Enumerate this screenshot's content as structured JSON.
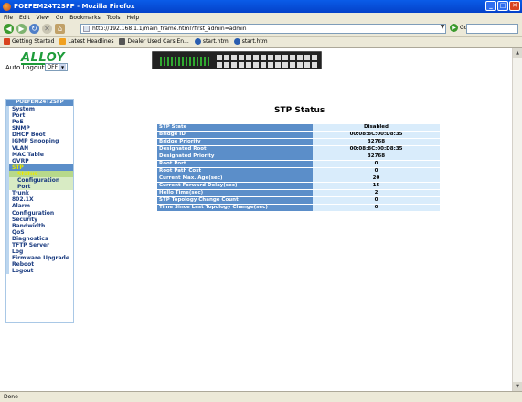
{
  "window": {
    "title": "POEFEM24T2SFP - Mozilla Firefox",
    "buttons": [
      "_",
      "□",
      "✕"
    ]
  },
  "menu": [
    "File",
    "Edit",
    "View",
    "Go",
    "Bookmarks",
    "Tools",
    "Help"
  ],
  "toolbar": {
    "url": "http://192.168.1.1/main_frame.html?first_admin=admin",
    "go_label": "Go"
  },
  "bookmarks": [
    {
      "label": "Getting Started",
      "color": "#d9431f"
    },
    {
      "label": "Latest Headlines",
      "color": "#f0a020"
    },
    {
      "label": "Dealer Used Cars En...",
      "color": "#555555"
    },
    {
      "label": "start.htm",
      "color": "#2a5db0"
    },
    {
      "label": "start.htm",
      "color": "#2a5db0"
    }
  ],
  "header": {
    "logo": "ALLOY",
    "auto_logout_label": "Auto Logout",
    "auto_logout_value": "OFF"
  },
  "sidebar": {
    "title": "POEFEM24T2SFP",
    "items": [
      {
        "label": "System"
      },
      {
        "label": "Port"
      },
      {
        "label": "PoE"
      },
      {
        "label": "SNMP"
      },
      {
        "label": "DHCP Boot"
      },
      {
        "label": "IGMP Snooping"
      },
      {
        "label": "VLAN"
      },
      {
        "label": "MAC Table"
      },
      {
        "label": "GVRP"
      },
      {
        "label": "STP"
      }
    ],
    "stp_sub": [
      {
        "label": "Status"
      },
      {
        "label": "Configuration"
      },
      {
        "label": "Port"
      }
    ],
    "items_after": [
      {
        "label": "Trunk"
      },
      {
        "label": "802.1X"
      },
      {
        "label": "Alarm"
      },
      {
        "label": "Configuration"
      },
      {
        "label": "Security"
      },
      {
        "label": "Bandwidth"
      },
      {
        "label": "QoS"
      },
      {
        "label": "Diagnostics"
      },
      {
        "label": "TFTP Server"
      },
      {
        "label": "Log"
      },
      {
        "label": "Firmware Upgrade"
      },
      {
        "label": "Reboot"
      },
      {
        "label": "Logout"
      }
    ]
  },
  "main": {
    "title": "STP Status",
    "rows": [
      {
        "label": "STP State",
        "value": "Disabled"
      },
      {
        "label": "Bridge ID",
        "value": "00:08:8C:00:D8:35"
      },
      {
        "label": "Bridge Priority",
        "value": "32768"
      },
      {
        "label": "Designated Root",
        "value": "00:08:8C:00:D8:35"
      },
      {
        "label": "Designated Priority",
        "value": "32768"
      },
      {
        "label": "Root Port",
        "value": "0"
      },
      {
        "label": "Root Path Cost",
        "value": "0"
      },
      {
        "label": "Current Max. Age(sec)",
        "value": "20"
      },
      {
        "label": "Current Forward Delay(sec)",
        "value": "15"
      },
      {
        "label": "Hello Time(sec)",
        "value": "2"
      },
      {
        "label": "STP Topology Change Count",
        "value": "0"
      },
      {
        "label": "Time Since Last Topology Change(sec)",
        "value": "0"
      }
    ]
  },
  "status": {
    "text": "Done"
  }
}
